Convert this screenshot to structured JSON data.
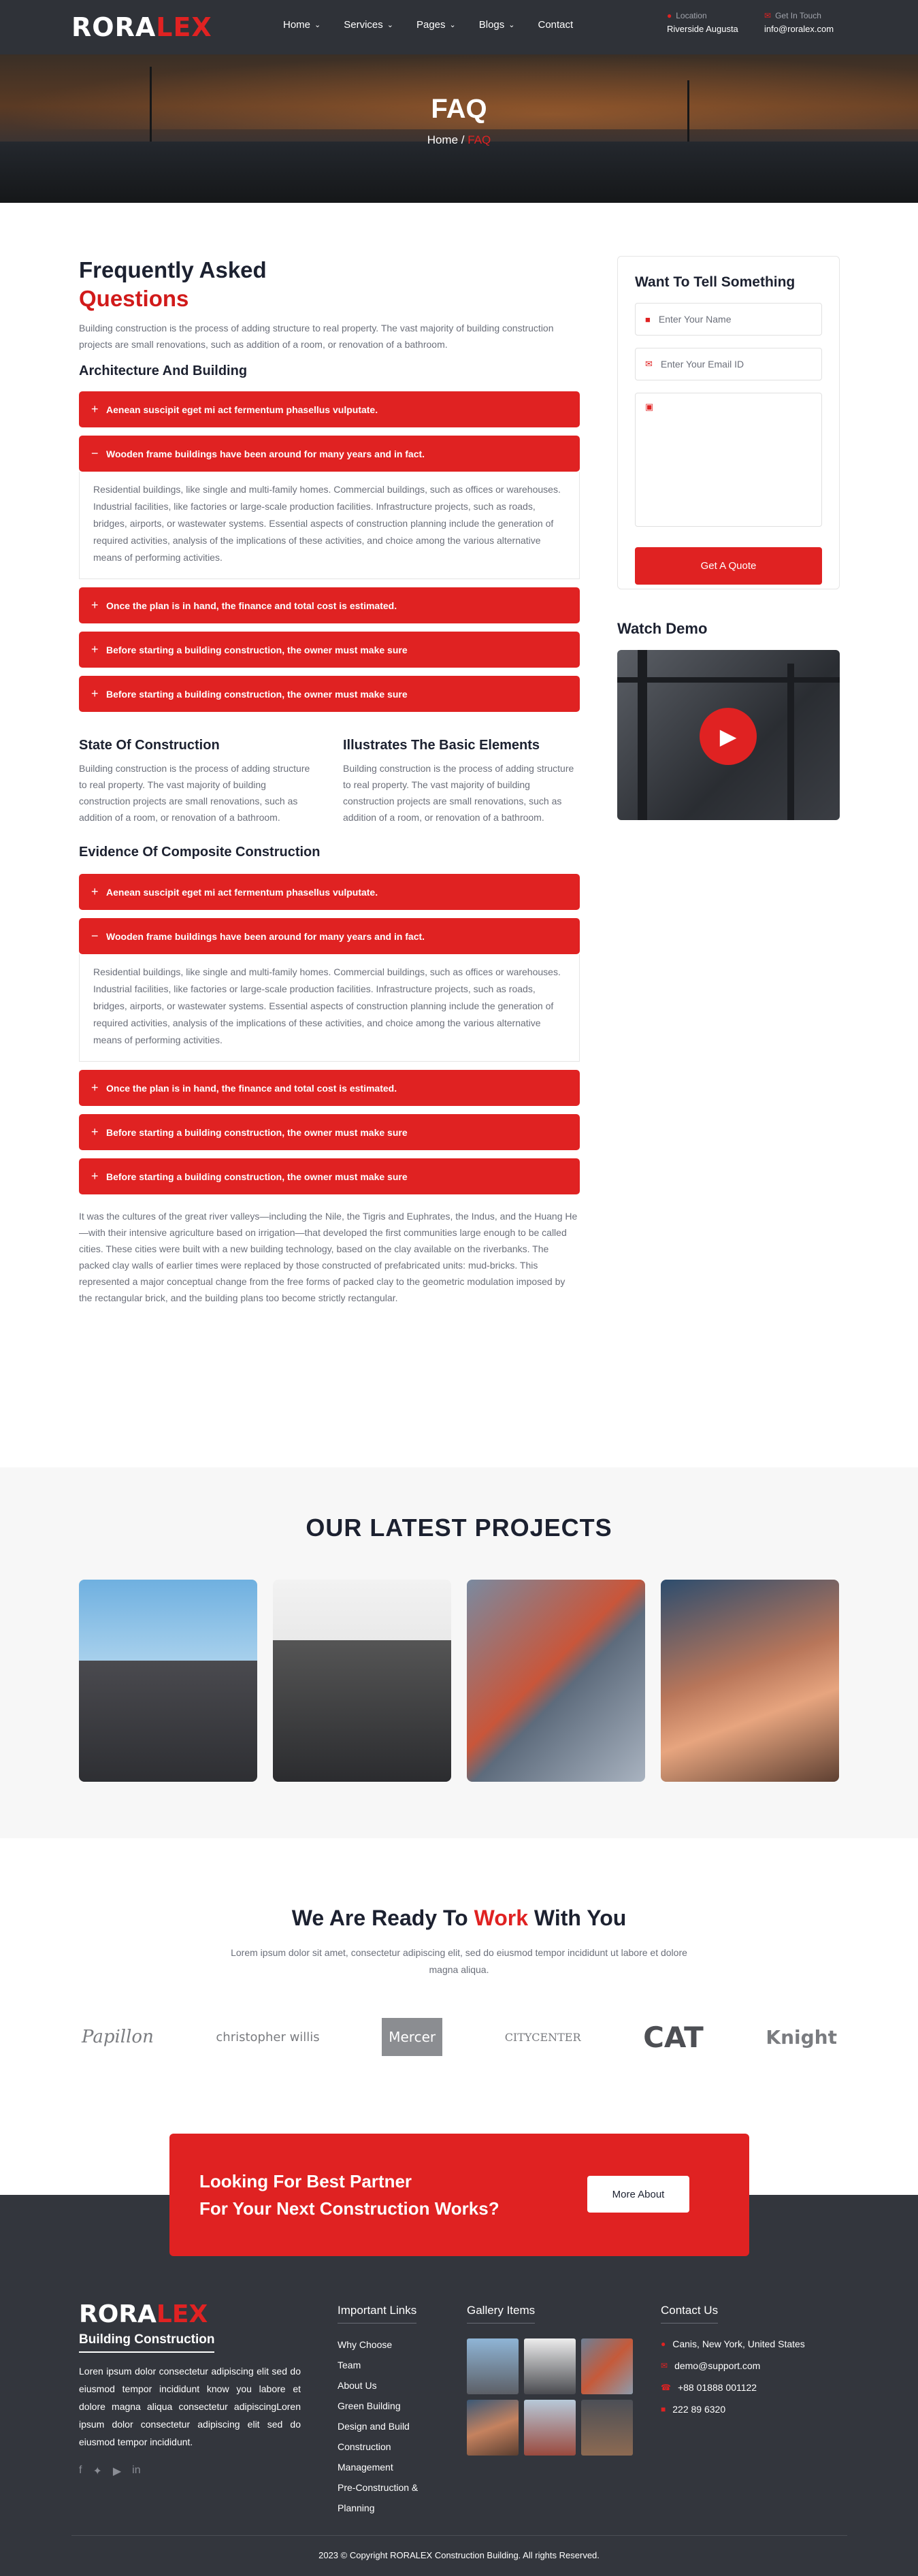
{
  "header": {
    "logo_a": "RORA",
    "logo_b": "LEX",
    "nav": [
      "Home",
      "Services",
      "Pages",
      "Blogs",
      "Contact"
    ],
    "location_label": "Location",
    "location_value": "Riverside Augusta",
    "touch_label": "Get In Touch",
    "touch_value": "info@roralex.com"
  },
  "hero": {
    "title": "FAQ",
    "crumb_home": "Home",
    "crumb_sep": "/",
    "crumb_current": "FAQ"
  },
  "faq": {
    "title_a": "Frequently Asked",
    "title_b": "Questions",
    "intro": "Building construction is the process of adding structure to real property. The vast majority of building construction projects are small renovations, such as addition of a room, or renovation of a bathroom.",
    "section1": "Architecture And Building",
    "accordion1": [
      "Aenean suscipit eget mi act fermentum phasellus vulputate.",
      "Wooden frame buildings have been around for many years and in fact.",
      "Once the plan is in hand, the finance and total cost is estimated.",
      "Before starting a building construction, the owner must make sure",
      "Before starting a building construction, the owner must make sure"
    ],
    "open_text": "Residential buildings, like single and multi-family homes. Commercial buildings, such as offices or warehouses. Industrial facilities, like factories or large-scale production facilities. Infrastructure projects, such as roads, bridges, airports, or wastewater systems. Essential aspects of construction planning include the generation of required activities, analysis of the implications of these activities, and choice among the various alternative means of performing activities.",
    "col1_title": "State Of Construction",
    "col1_text": "Building construction is the process of adding structure to real property. The vast majority of building construction projects are small renovations, such as addition of a room, or renovation of a bathroom.",
    "col2_title": "Illustrates The Basic Elements",
    "col2_text": "Building construction is the process of adding structure to real property. The vast majority of building construction projects are small renovations, such as addition of a room, or renovation of a bathroom.",
    "section2": "Evidence Of Composite Construction",
    "accordion2": [
      "Aenean suscipit eget mi act fermentum phasellus vulputate.",
      "Wooden frame buildings have been around for many years and in fact.",
      "Once the plan is in hand, the finance and total cost is estimated.",
      "Before starting a building construction, the owner must make sure",
      "Before starting a building construction, the owner must make sure"
    ],
    "outro": "It was the cultures of the great river valleys—including the Nile, the Tigris and Euphrates, the Indus, and the Huang He—with their intensive agriculture based on irrigation—that developed the first communities large enough to be called cities. These cities were built with a new building technology, based on the clay available on the riverbanks. The packed clay walls of earlier times were replaced by those constructed of prefabricated units: mud-bricks. This represented a major conceptual change from the free forms of packed clay to the geometric modulation imposed by the rectangular brick, and the building plans too become strictly rectangular."
  },
  "form": {
    "title": "Want To Tell Something",
    "name_ph": "Enter Your Name",
    "email_ph": "Enter Your Email ID",
    "button": "Get A Quote",
    "watch": "Watch Demo"
  },
  "projects": {
    "title": "OUR LATEST PROJECTS"
  },
  "ready": {
    "title_a": "We Are Ready To ",
    "title_b": "Work",
    "title_c": " With You",
    "sub": "Lorem ipsum dolor sit amet, consectetur adipiscing elit, sed do eiusmod tempor incididunt ut labore et dolore magna aliqua."
  },
  "partners": [
    "Papillon",
    "christopher willis",
    "Mercer",
    "CITYCENTER",
    "CAT",
    "Knight"
  ],
  "cta": {
    "line1": "Looking For Best Partner",
    "line2": "For Your Next Construction Works?",
    "button": "More About"
  },
  "footer": {
    "logo_a": "RORA",
    "logo_b": "LEX",
    "tagline": "Building Construction",
    "about": "Loren ipsum dolor consectetur adipiscing elit sed do eiusmod tempor incididunt know you labore et dolore magna aliqua consectetur adipiscingLoren ipsum dolor consectetur adipiscing elit sed do eiusmod tempor incididunt.",
    "links_title": "Important Links",
    "links": [
      "Why Choose",
      "Team",
      "About Us",
      "Green Building",
      "Design and Build",
      "Construction",
      "Management",
      "Pre-Construction &",
      "Planning"
    ],
    "gallery_title": "Gallery Items",
    "contact_title": "Contact Us",
    "contact": [
      "Canis, New York, United States",
      "demo@support.com",
      "+88 01888 001122",
      "222 89 6320"
    ],
    "copyright": "2023 © Copyright RORALEX Construction Building. All rights Reserved."
  },
  "colors": {
    "accent": "#e02222",
    "dark": "#33363d",
    "heading": "#1c2130"
  }
}
